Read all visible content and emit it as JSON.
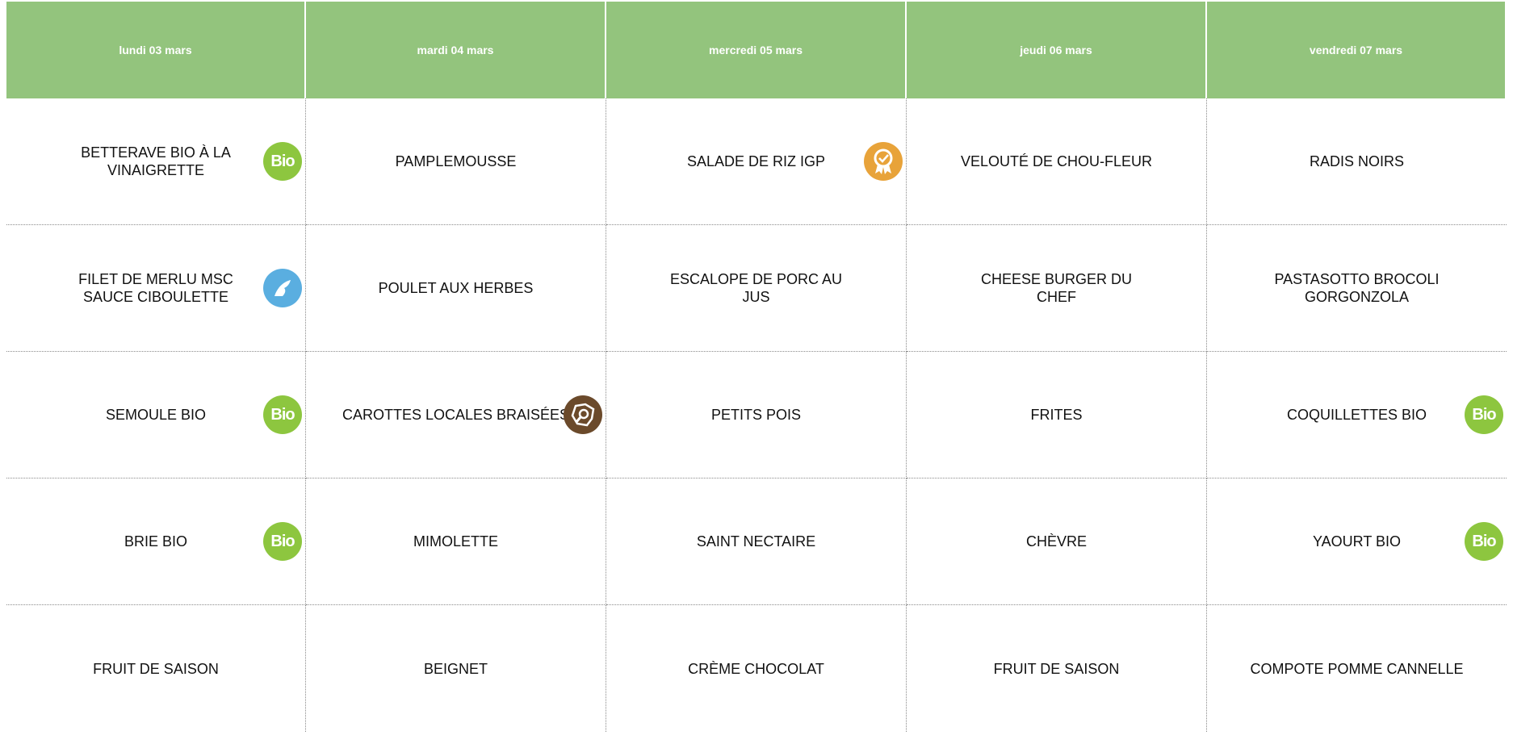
{
  "days": [
    "lundi 03 mars",
    "mardi 04 mars",
    "mercredi 05 mars",
    "jeudi 06 mars",
    "vendredi 07 mars"
  ],
  "rows": [
    [
      "BETTERAVE BIO À LA VINAIGRETTE",
      "PAMPLEMOUSSE",
      "SALADE DE RIZ IGP",
      "VELOUTÉ DE CHOU-FLEUR",
      "RADIS NOIRS"
    ],
    [
      "FILET DE MERLU MSC SAUCE CIBOULETTE",
      "POULET AUX HERBES",
      "ESCALOPE DE PORC AU JUS",
      "CHEESE BURGER DU CHEF",
      "PASTASOTTO BROCOLI GORGONZOLA"
    ],
    [
      "SEMOULE BIO",
      "CAROTTES LOCALES BRAISÉES",
      "PETITS POIS",
      "FRITES",
      "COQUILLETTES BIO"
    ],
    [
      "BRIE BIO",
      "MIMOLETTE",
      "SAINT NECTAIRE",
      "CHÈVRE",
      "YAOURT BIO"
    ],
    [
      "FRUIT DE SAISON",
      "BEIGNET",
      "CRÈME CHOCOLAT",
      "FRUIT DE SAISON",
      "COMPOTE POMME CANNELLE"
    ]
  ],
  "badges": {
    "bio_text": "Bio",
    "bio_color": "#8dc63f",
    "igp_color": "#e8a33a",
    "msc_color": "#5aaee0",
    "local_color": "#6b4a2b"
  },
  "colors": {
    "header_bg": "#93c47d",
    "header_text": "#ffffff"
  }
}
